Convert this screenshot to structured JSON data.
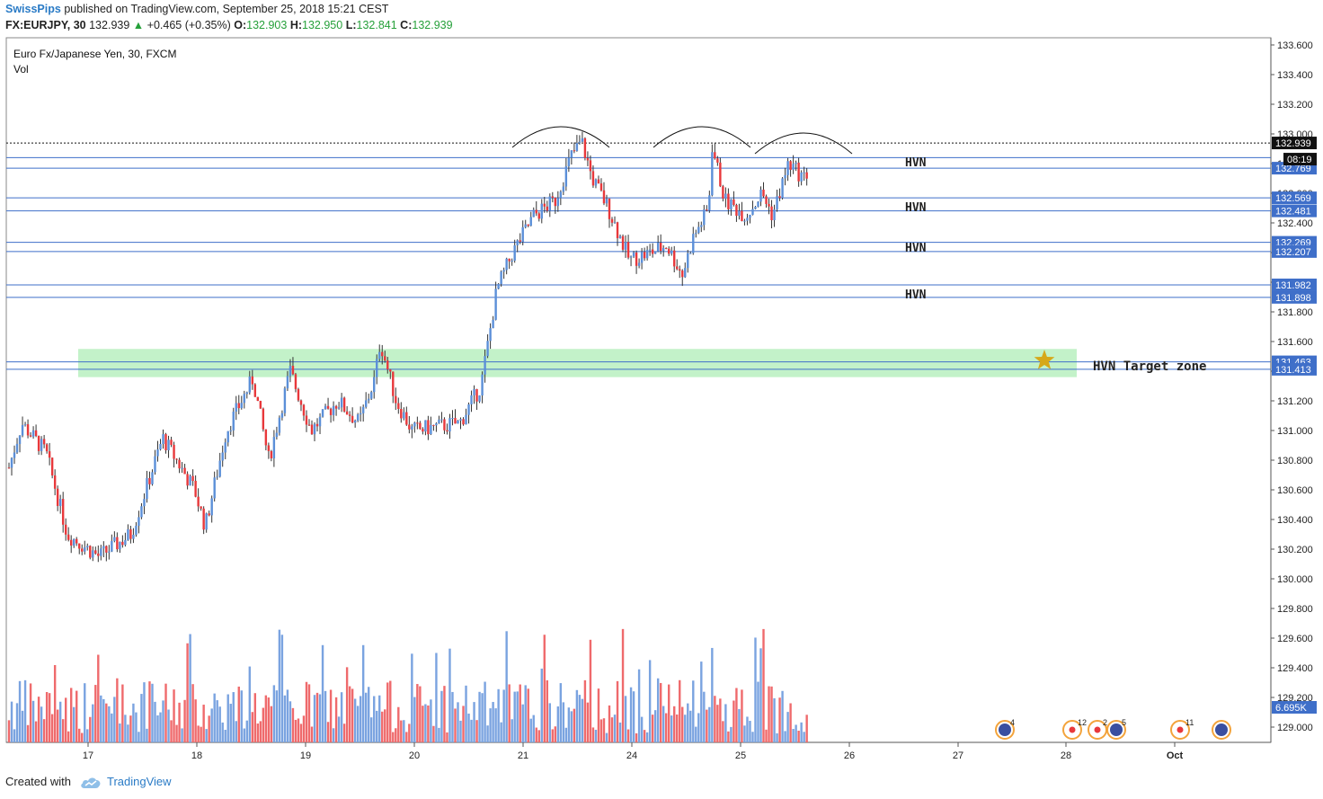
{
  "header": {
    "author": "SwissPips",
    "published": "published on TradingView.com, September 25, 2018 15:21 CEST",
    "symbol": "FX:EURJPY, 30",
    "last": "132.939",
    "change_arrow": "▲",
    "change": "+0.465 (+0.35%)",
    "o_label": "O:",
    "o_value": "132.903",
    "h_label": "H:",
    "h_value": "132.950",
    "l_label": "L:",
    "l_value": "132.841",
    "c_label": "C:",
    "c_value": "132.939"
  },
  "chart_data": {
    "type": "candlestick",
    "title": "Euro Fx/Japanese Yen, 30, FXCM",
    "volume_label": "Vol",
    "ylim": [
      128.9,
      133.65
    ],
    "y_ticks": [
      "133.600",
      "133.400",
      "133.200",
      "133.000",
      "132.800",
      "132.600",
      "132.400",
      "132.200",
      "132.000",
      "131.800",
      "131.600",
      "131.400",
      "131.200",
      "131.000",
      "130.800",
      "130.600",
      "130.400",
      "130.200",
      "130.000",
      "129.800",
      "129.600",
      "129.400",
      "129.200",
      "129.000"
    ],
    "x_ticks": [
      "17",
      "18",
      "19",
      "20",
      "21",
      "24",
      "25",
      "26",
      "27",
      "28",
      "Oct"
    ],
    "anchors": [
      {
        "day": 0.0,
        "price": 130.75
      },
      {
        "day": 0.12,
        "price": 131.05
      },
      {
        "day": 0.35,
        "price": 130.85
      },
      {
        "day": 0.55,
        "price": 130.3
      },
      {
        "day": 0.85,
        "price": 130.15
      },
      {
        "day": 1.15,
        "price": 130.3
      },
      {
        "day": 1.45,
        "price": 130.95
      },
      {
        "day": 1.75,
        "price": 130.6
      },
      {
        "day": 1.85,
        "price": 130.35
      },
      {
        "day": 2.05,
        "price": 131.0
      },
      {
        "day": 2.3,
        "price": 131.35
      },
      {
        "day": 2.45,
        "price": 130.8
      },
      {
        "day": 2.65,
        "price": 131.4
      },
      {
        "day": 2.85,
        "price": 131.0
      },
      {
        "day": 3.1,
        "price": 131.2
      },
      {
        "day": 3.3,
        "price": 131.05
      },
      {
        "day": 3.45,
        "price": 131.35
      },
      {
        "day": 3.5,
        "price": 131.6
      },
      {
        "day": 3.65,
        "price": 131.2
      },
      {
        "day": 3.8,
        "price": 131.0
      },
      {
        "day": 4.25,
        "price": 131.05
      },
      {
        "day": 4.45,
        "price": 131.3
      },
      {
        "day": 4.6,
        "price": 131.95
      },
      {
        "day": 4.75,
        "price": 132.2
      },
      {
        "day": 4.95,
        "price": 132.45
      },
      {
        "day": 5.15,
        "price": 132.55
      },
      {
        "day": 5.3,
        "price": 132.85
      },
      {
        "day": 5.4,
        "price": 132.95
      },
      {
        "day": 5.5,
        "price": 132.7
      },
      {
        "day": 5.65,
        "price": 132.5
      },
      {
        "day": 5.85,
        "price": 132.15
      },
      {
        "day": 6.05,
        "price": 132.2
      },
      {
        "day": 6.2,
        "price": 132.25
      },
      {
        "day": 6.35,
        "price": 132.05
      },
      {
        "day": 6.45,
        "price": 132.3
      },
      {
        "day": 6.6,
        "price": 132.5
      },
      {
        "day": 6.62,
        "price": 132.95
      },
      {
        "day": 6.75,
        "price": 132.55
      },
      {
        "day": 6.95,
        "price": 132.45
      },
      {
        "day": 7.1,
        "price": 132.6
      },
      {
        "day": 7.2,
        "price": 132.45
      },
      {
        "day": 7.35,
        "price": 132.8
      },
      {
        "day": 7.5,
        "price": 132.7
      },
      {
        "day": 7.65,
        "price": 132.93
      }
    ],
    "levels": [
      {
        "price": 132.939,
        "label": "132.939",
        "current": true
      },
      {
        "price": 132.84
      },
      {
        "price": 132.769,
        "label": "132.769"
      },
      {
        "price": 132.569,
        "label": "132.569"
      },
      {
        "price": 132.481,
        "label": "132.481"
      },
      {
        "price": 132.269,
        "label": "132.269"
      },
      {
        "price": 132.207,
        "label": "132.207"
      },
      {
        "price": 131.982,
        "label": "131.982"
      },
      {
        "price": 131.898,
        "label": "131.898"
      },
      {
        "price": 131.463,
        "label": "131.463"
      },
      {
        "price": 131.413,
        "label": "131.413"
      }
    ],
    "annotations": {
      "hvn": [
        "HVN",
        "HVN",
        "HVN",
        "HVN"
      ],
      "target_zone": "HVN Target zone",
      "countdown": "08:19",
      "volume_value": "6.695K"
    },
    "event_counts": [
      "4",
      "12",
      "2",
      "5",
      "11"
    ],
    "colors": {
      "up": "#5b8fd8",
      "down": "#e8383b",
      "level": "#3f6fc9",
      "zone": "#b9f0c0",
      "star": "#d6a81a",
      "vol_up": "#7aa3e0",
      "vol_down": "#ef6a6c"
    }
  },
  "footer": {
    "created_with": "Created with",
    "brand": "TradingView"
  }
}
